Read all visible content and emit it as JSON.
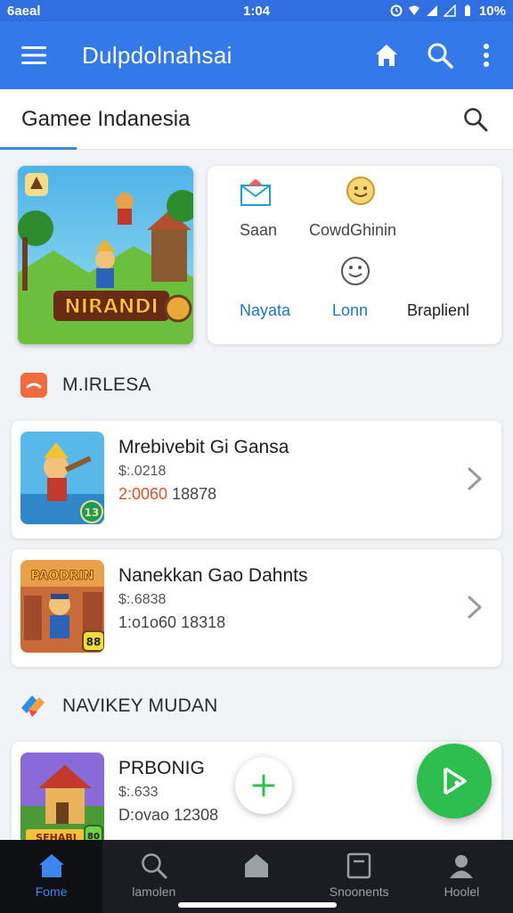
{
  "status_bar": {
    "carrier": "6aeal",
    "time": "1:04",
    "battery": "10%"
  },
  "app_bar": {
    "title": "Dulpdolnahsai"
  },
  "search": {
    "value": "Gamee Indanesia"
  },
  "quick_actions": {
    "items": [
      {
        "label": "Saan",
        "icon": "mail-icon"
      },
      {
        "label": "CowdGhinin",
        "icon": "smile-coin-icon"
      },
      {
        "label": "Nayata",
        "icon": "none"
      },
      {
        "label": "Lonn",
        "icon": "smiley-icon"
      },
      {
        "label": "Braplienl",
        "icon": "none"
      }
    ]
  },
  "hero": {
    "banner_text": "NIRANDI"
  },
  "sections": [
    {
      "title": "M.IRLESA",
      "icon": "folder-icon"
    },
    {
      "title": "NAVIKEY MUDAN",
      "icon": "app-logo-icon"
    }
  ],
  "games": [
    {
      "title": "Mrebivebit Gi Gansa",
      "sub": "$:.0218",
      "meta_accent": "2:0060",
      "meta": "18878",
      "badge": "13"
    },
    {
      "title": "Nanekkan Gao Dahnts",
      "sub": "$:.6838",
      "meta_accent": "",
      "meta": "1:o1o60 18318",
      "badge": "88",
      "thumb_text": "PAODRIN"
    },
    {
      "title": "PRBONIG",
      "sub": "$:.633",
      "meta_accent": "",
      "meta": "D:ovao 12308",
      "badge": "80",
      "thumb_text": "SEHABI"
    }
  ],
  "bottom_nav": [
    {
      "label": "Fome",
      "icon": "home-icon",
      "active": true
    },
    {
      "label": "lamolen",
      "icon": "search-icon",
      "active": false
    },
    {
      "label": "",
      "icon": "house-icon",
      "active": false
    },
    {
      "label": "Snoonents",
      "icon": "document-icon",
      "active": false
    },
    {
      "label": "Hoolel",
      "icon": "profile-icon",
      "active": false
    }
  ],
  "colors": {
    "primary": "#3479ea",
    "accent_green": "#2ebd4f",
    "nav_active": "#3b86f0",
    "price_accent": "#d9542c"
  }
}
